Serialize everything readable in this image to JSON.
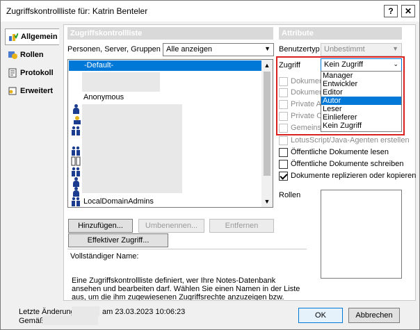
{
  "window": {
    "title": "Zugriffskontrollliste für: Katrin Benteler",
    "help_label": "?",
    "close_label": "✕"
  },
  "sidebar": {
    "items": [
      {
        "label": "Allgemein",
        "icon": "people-check-icon"
      },
      {
        "label": "Rollen",
        "icon": "roles-icon"
      },
      {
        "label": "Protokoll",
        "icon": "log-icon"
      },
      {
        "label": "Erweitert",
        "icon": "advanced-icon"
      }
    ]
  },
  "acl": {
    "section_title": "Zugriffskontrollliste",
    "filter_label": "Personen, Server, Gruppen",
    "filter_value": "Alle anzeigen",
    "list_items": [
      "-Default-",
      "Anonymous",
      "LocalDomainAdmins"
    ]
  },
  "buttons": {
    "add": "Hinzufügen...",
    "rename": "Umbenennen...",
    "remove": "Entfernen",
    "effective": "Effektiver Zugriff...",
    "ok": "OK",
    "cancel": "Abbrechen"
  },
  "fullname_label": "Vollständiger Name:",
  "description": "Eine Zugriffskontrollliste definiert, wer Ihre Notes-Datenbank ansehen und bearbeiten darf. Wählen Sie einen Namen in der Liste aus, um die ihm zugewiesenen Zugriffsrechte anzuzeigen bzw. festzulegen.",
  "footer": {
    "last_change_label": "Letzte Änderung:",
    "last_change_value": "am 23.03.2023 10:06:23",
    "by_label": "Gemäß:"
  },
  "attributes": {
    "section_title": "Attribute",
    "user_type_label": "Benutzertyp",
    "user_type_value": "Unbestimmt",
    "access_label": "Zugriff",
    "access_value": "Kein Zugriff",
    "access_options": [
      "Manager",
      "Entwickler",
      "Editor",
      "Autor",
      "Leser",
      "Einlieferer",
      "Kein Zugriff"
    ],
    "highlighted_option": "Autor",
    "hidden_checkboxes": [
      "Dokument",
      "Dokument",
      "Private Ag",
      "Private Or",
      "Gemeins."
    ],
    "checkboxes": [
      {
        "label": "LotusScript/Java-Agenten erstellen",
        "checked": false,
        "disabled": true
      },
      {
        "label": "Öffentliche Dokumente lesen",
        "checked": false,
        "disabled": false
      },
      {
        "label": "Öffentliche Dokumente schreiben",
        "checked": false,
        "disabled": false
      },
      {
        "label": "Dokumente replizieren oder kopieren",
        "checked": true,
        "disabled": false
      }
    ],
    "roles_label": "Rollen"
  },
  "colors": {
    "selection": "#0078d7",
    "highlight_border": "#d9201f",
    "section_header": "#d9d9d9"
  }
}
